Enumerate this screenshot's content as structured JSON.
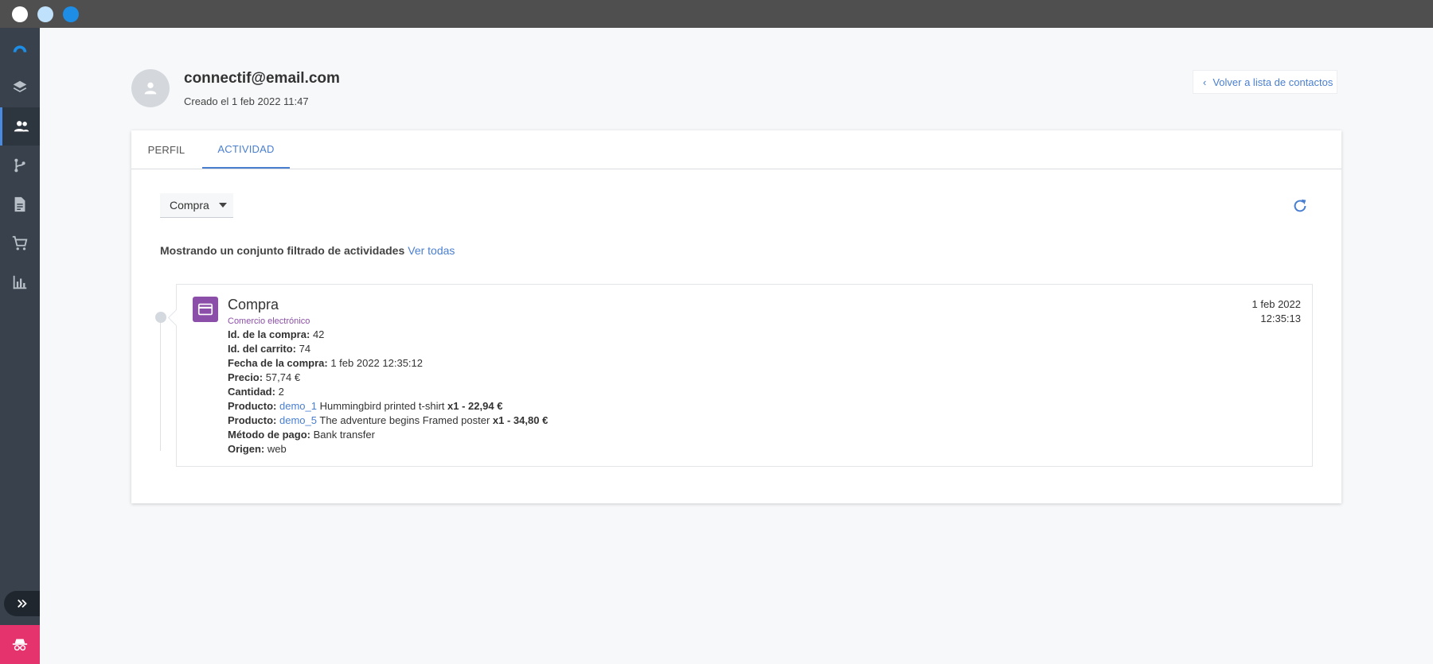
{
  "window": {
    "dots": [
      "close",
      "minimize",
      "maximize"
    ]
  },
  "sidebar": {
    "items": [
      {
        "name": "logo-icon"
      },
      {
        "name": "layers-icon"
      },
      {
        "name": "contacts-icon",
        "active": true
      },
      {
        "name": "workflow-icon"
      },
      {
        "name": "document-icon"
      },
      {
        "name": "cart-icon"
      },
      {
        "name": "chart-icon"
      }
    ],
    "expand_icon": "double-chevron-right-icon",
    "bottom_icon": "incognito-icon"
  },
  "contact": {
    "email": "connectif@email.com",
    "created": "Creado el 1 feb 2022 11:47"
  },
  "back_button": {
    "label": "Volver a lista de contactos"
  },
  "tabs": [
    {
      "label": "PERFIL",
      "active": false
    },
    {
      "label": "ACTIVIDAD",
      "active": true
    }
  ],
  "filter": {
    "selected": "Compra"
  },
  "filtered_note": {
    "text": "Mostrando un conjunto filtrado de actividades",
    "link": "Ver todas"
  },
  "activity": {
    "title": "Compra",
    "subtitle": "Comercio electrónico",
    "date": "1 feb 2022",
    "time": "12:35:13",
    "fields": {
      "purchase_id": {
        "label": "Id. de la compra:",
        "value": "42"
      },
      "cart_id": {
        "label": "Id. del carrito:",
        "value": "74"
      },
      "purchase_date": {
        "label": "Fecha de la compra:",
        "value": "1 feb 2022 12:35:12"
      },
      "price": {
        "label": "Precio:",
        "value": "57,74 €"
      },
      "quantity": {
        "label": "Cantidad:",
        "value": "2"
      },
      "products": [
        {
          "label": "Producto:",
          "id": "demo_1",
          "name": "Hummingbird printed t-shirt",
          "qty_price": "x1 - 22,94 €"
        },
        {
          "label": "Producto:",
          "id": "demo_5",
          "name": "The adventure begins Framed poster",
          "qty_price": "x1 - 34,80 €"
        }
      ],
      "payment_method": {
        "label": "Método de pago:",
        "value": "Bank transfer"
      },
      "origin": {
        "label": "Origen:",
        "value": "web"
      }
    }
  },
  "colors": {
    "sidebar": "#38414c",
    "accent": "#4a7fd0",
    "ecommerce": "#8c4fa9",
    "alert": "#e5336d"
  }
}
